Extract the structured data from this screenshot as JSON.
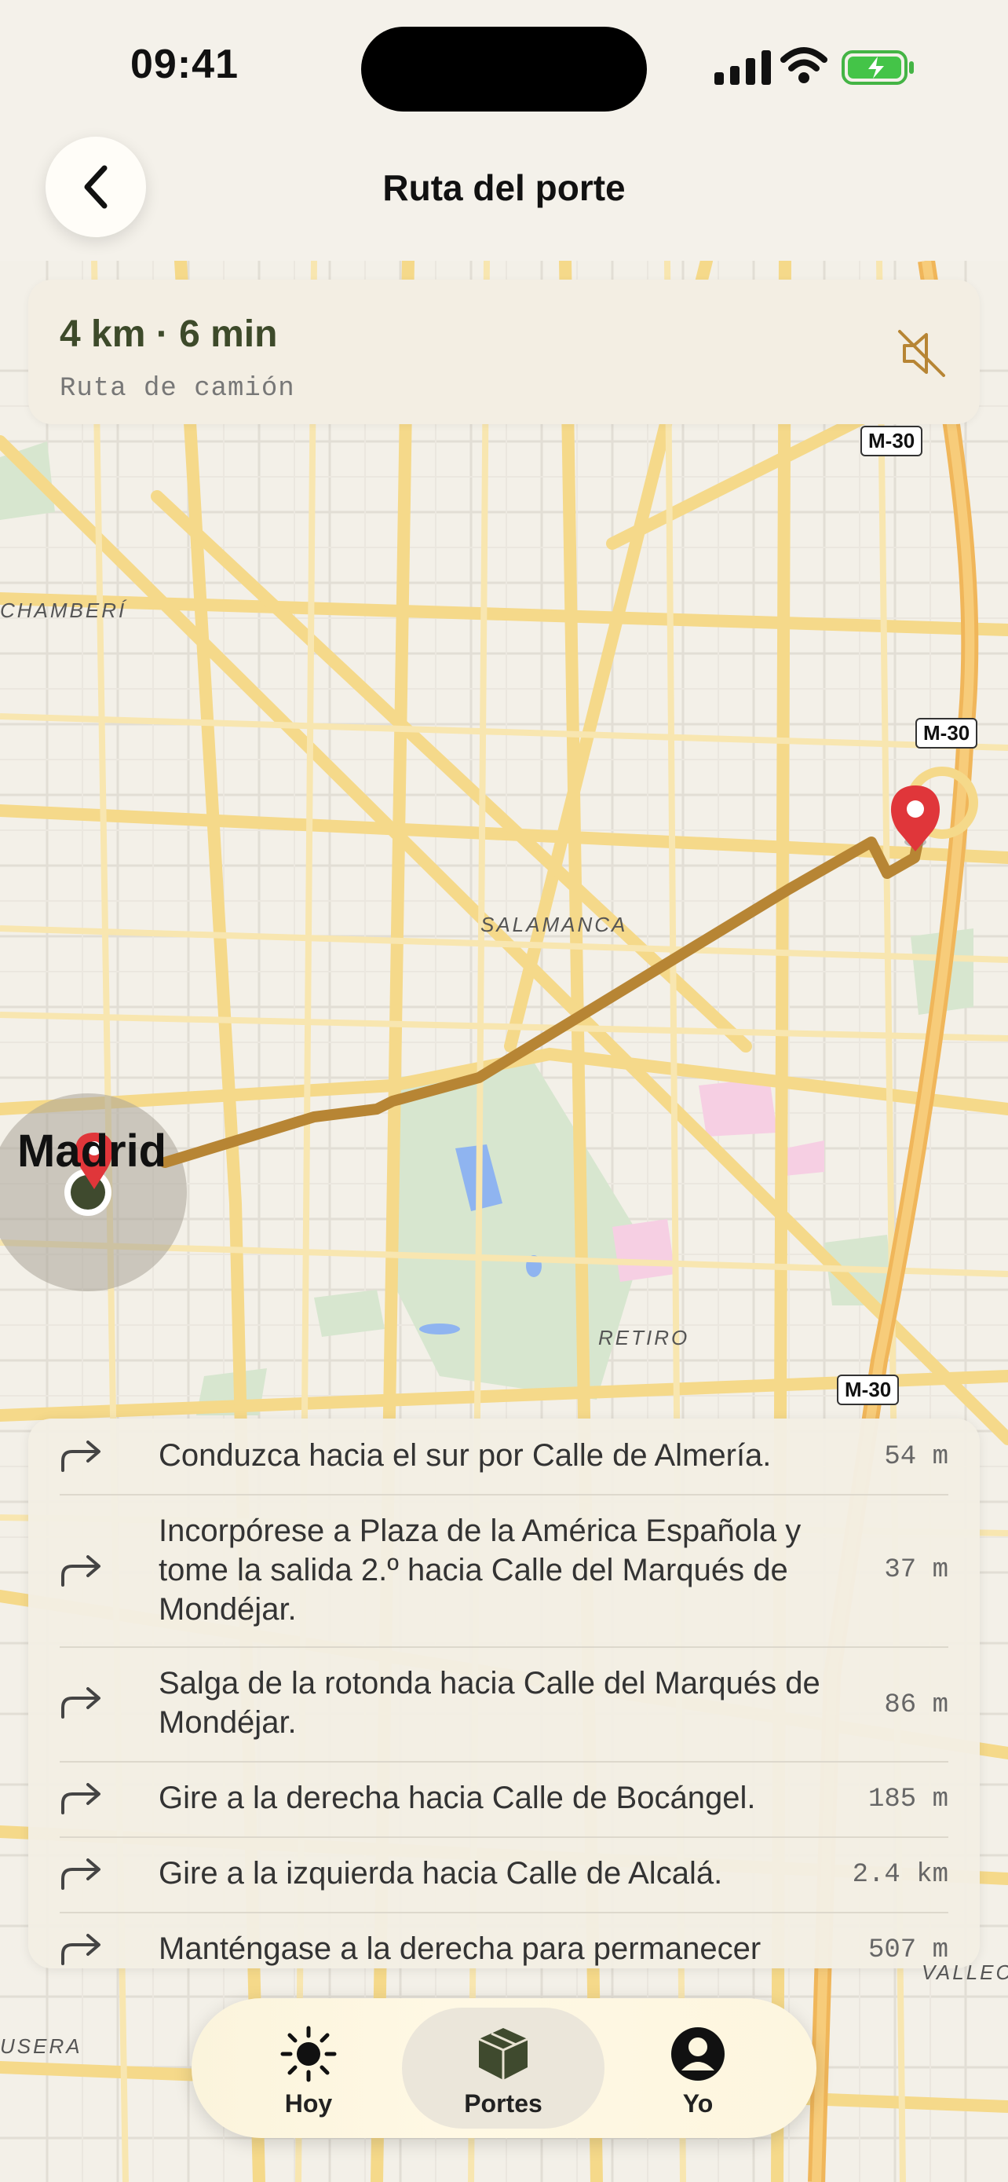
{
  "status_bar": {
    "time": "09:41"
  },
  "header": {
    "title": "Ruta del porte"
  },
  "summary": {
    "distance_time": "4 km · 6 min",
    "route_type": "Ruta de camión"
  },
  "map": {
    "labels": {
      "chamberi": "CHAMBERÍ",
      "salamanca": "SALAMANCA",
      "retiro": "RETIRO",
      "usera": "USERA",
      "vallecas": "VALLECA",
      "madrid": "Madrid"
    },
    "shields": [
      "M-30",
      "M-30",
      "M-30"
    ],
    "route_color": "#b78534",
    "origin_color": "#3f4a2e",
    "pin_color": "#e0363a"
  },
  "steps": [
    {
      "text": "Conduzca hacia el sur por Calle de Almería.",
      "distance": "54 m"
    },
    {
      "text": "Incorpórese a Plaza de la América Española y tome la salida 2.º hacia Calle del Marqués de Mondéjar.",
      "distance": "37 m"
    },
    {
      "text": "Salga de la rotonda hacia Calle del Marqués de Mondéjar.",
      "distance": "86 m"
    },
    {
      "text": "Gire a la derecha hacia Calle de Bocángel.",
      "distance": "185 m"
    },
    {
      "text": "Gire a la izquierda hacia Calle de Alcalá.",
      "distance": "2.4 km"
    },
    {
      "text": "Manténgase a la derecha para permanecer",
      "distance": "507 m"
    }
  ],
  "tabs": [
    {
      "label": "Hoy",
      "icon": "sun-icon"
    },
    {
      "label": "Portes",
      "icon": "package-icon"
    },
    {
      "label": "Yo",
      "icon": "person-icon"
    }
  ]
}
